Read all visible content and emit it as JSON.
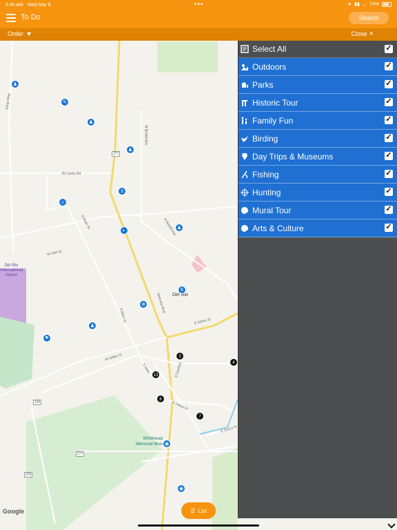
{
  "status": {
    "time": "5:45 AM",
    "date": "Wed Mar 6",
    "battery": "74%"
  },
  "header": {
    "title": "To Do",
    "search_label": "Search"
  },
  "toolbar": {
    "order_label": "Order",
    "close_label": "Close"
  },
  "map": {
    "roads": [
      "W Cantu Rd",
      "W 15th St",
      "N Main St",
      "N Bedell Ave",
      "Veterans Blvd",
      "E Gibbs St",
      "W Gibbs St",
      "S Main",
      "E Canal St",
      "E Garza St",
      "E Garfield",
      "Kings Way",
      "N Bedell Ave",
      "S Main St"
    ],
    "city_label": "Del Rio",
    "airport_label": "Del Rio\nInternational\nAirport",
    "museum_label": "Whitehead\nMemorial Museum",
    "google_label": "Google",
    "highways": [
      "377",
      "277",
      "239",
      "239"
    ],
    "numbered_markers": [
      "3",
      "13",
      "6",
      "7",
      "4",
      "3",
      "6"
    ]
  },
  "list_button": {
    "label": "List"
  },
  "panel": {
    "items": [
      {
        "label": "Select All",
        "icon": "list-icon",
        "checked": true
      },
      {
        "label": "Outdoors",
        "icon": "outdoors-icon",
        "checked": true
      },
      {
        "label": "Parks",
        "icon": "park-icon",
        "checked": true
      },
      {
        "label": "Historic Tour",
        "icon": "historic-icon",
        "checked": true
      },
      {
        "label": "Family Fun",
        "icon": "family-icon",
        "checked": true
      },
      {
        "label": "Birding",
        "icon": "bird-icon",
        "checked": true
      },
      {
        "label": "Day Trips & Museums",
        "icon": "museum-icon",
        "checked": true
      },
      {
        "label": "Fishing",
        "icon": "fishing-icon",
        "checked": true
      },
      {
        "label": "Hunting",
        "icon": "target-icon",
        "checked": true
      },
      {
        "label": "Mural Tour",
        "icon": "palette-icon",
        "checked": true
      },
      {
        "label": "Arts & Culture",
        "icon": "arts-icon",
        "checked": true
      }
    ]
  }
}
